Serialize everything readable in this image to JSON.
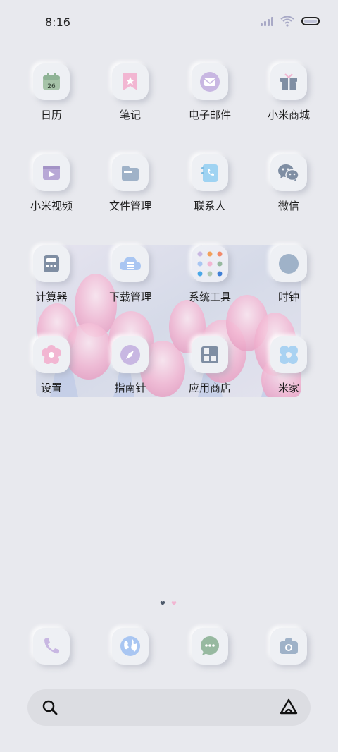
{
  "status": {
    "time": "8:16"
  },
  "apps_row1": [
    {
      "label": "日历",
      "calendar_number": "26"
    },
    {
      "label": "笔记"
    },
    {
      "label": "电子邮件"
    },
    {
      "label": "小米商城"
    }
  ],
  "apps_row2": [
    {
      "label": "小米视频"
    },
    {
      "label": "文件管理"
    },
    {
      "label": "联系人"
    },
    {
      "label": "微信"
    }
  ],
  "apps_row3": [
    {
      "label": "计算器"
    },
    {
      "label": "下载管理"
    },
    {
      "label": "系统工具"
    },
    {
      "label": "时钟"
    }
  ],
  "apps_row4": [
    {
      "label": "设置"
    },
    {
      "label": "指南针"
    },
    {
      "label": "应用商店"
    },
    {
      "label": "米家"
    }
  ],
  "dock": [
    {
      "icon": "phone-icon"
    },
    {
      "icon": "browser-icon"
    },
    {
      "icon": "messages-icon"
    },
    {
      "icon": "camera-icon"
    }
  ],
  "colors": {
    "background": "#e8e9ee",
    "accent_pink": "#f2b6d2",
    "accent_blue": "#9fb2c8",
    "accent_green": "#97b9a0",
    "accent_purple": "#c8b7e2"
  }
}
